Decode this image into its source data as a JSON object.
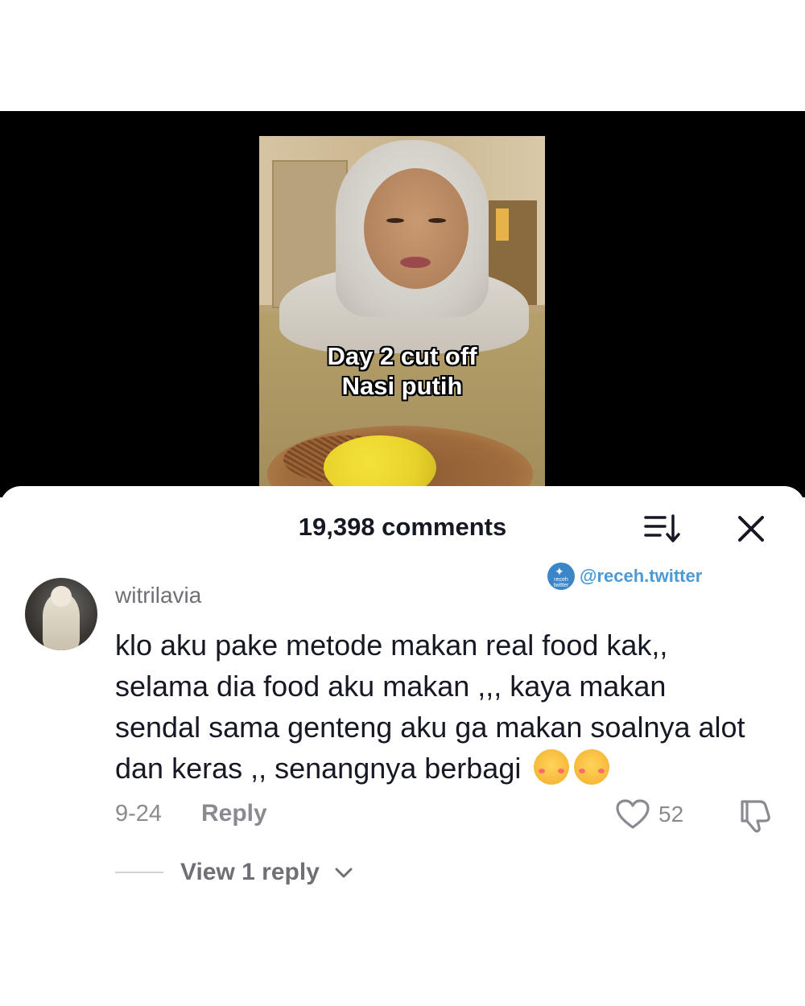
{
  "video": {
    "caption_line1": "Day 2 cut off",
    "caption_line2": "Nasi putih"
  },
  "comments_panel": {
    "title": "19,398 comments",
    "sort_icon": "sort-icon",
    "close_icon": "close-icon"
  },
  "watermark": {
    "badge_text": "receh twitter",
    "handle": "@receh.twitter"
  },
  "comment": {
    "username": "witrilavia",
    "text": "klo aku pake metode makan real food kak,, selama dia food aku makan ,,, kaya makan sendal sama genteng aku ga makan soalnya alot dan keras ,, senangnya berbagi",
    "emoji": [
      "🥰",
      "🥰"
    ],
    "date": "9-24",
    "reply_label": "Reply",
    "likes": "52",
    "view_replies_label": "View 1 reply"
  },
  "colors": {
    "text_primary": "#161823",
    "text_secondary": "#8a8b91",
    "watermark_blue": "#4a9ad8"
  }
}
